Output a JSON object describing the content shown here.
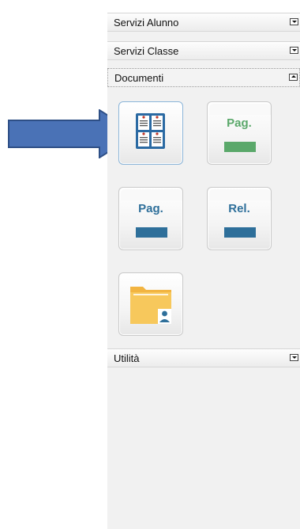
{
  "sidebar": {
    "sections": [
      {
        "label": "Servizi Alunno",
        "state": "collapsed"
      },
      {
        "label": "Servizi Classe",
        "state": "collapsed"
      },
      {
        "label": "Documenti",
        "state": "expanded"
      },
      {
        "label": "Utilità",
        "state": "collapsed"
      }
    ]
  },
  "documents": {
    "tiles": [
      {
        "icon": "documents-grid-icon",
        "highlighted": true
      },
      {
        "text": "Pag.",
        "bar_color": "#5aa86a",
        "text_color": "#5aa86a"
      },
      {
        "text": "Pag.",
        "bar_color": "#2e6f9a",
        "text_color": "#2e6f9a"
      },
      {
        "text": "Rel.",
        "bar_color": "#2e6f9a",
        "text_color": "#2e6f9a"
      },
      {
        "icon": "folder-user-icon"
      }
    ]
  },
  "annotation": {
    "icon": "blue-arrow-icon",
    "color": "#4a72b6"
  }
}
